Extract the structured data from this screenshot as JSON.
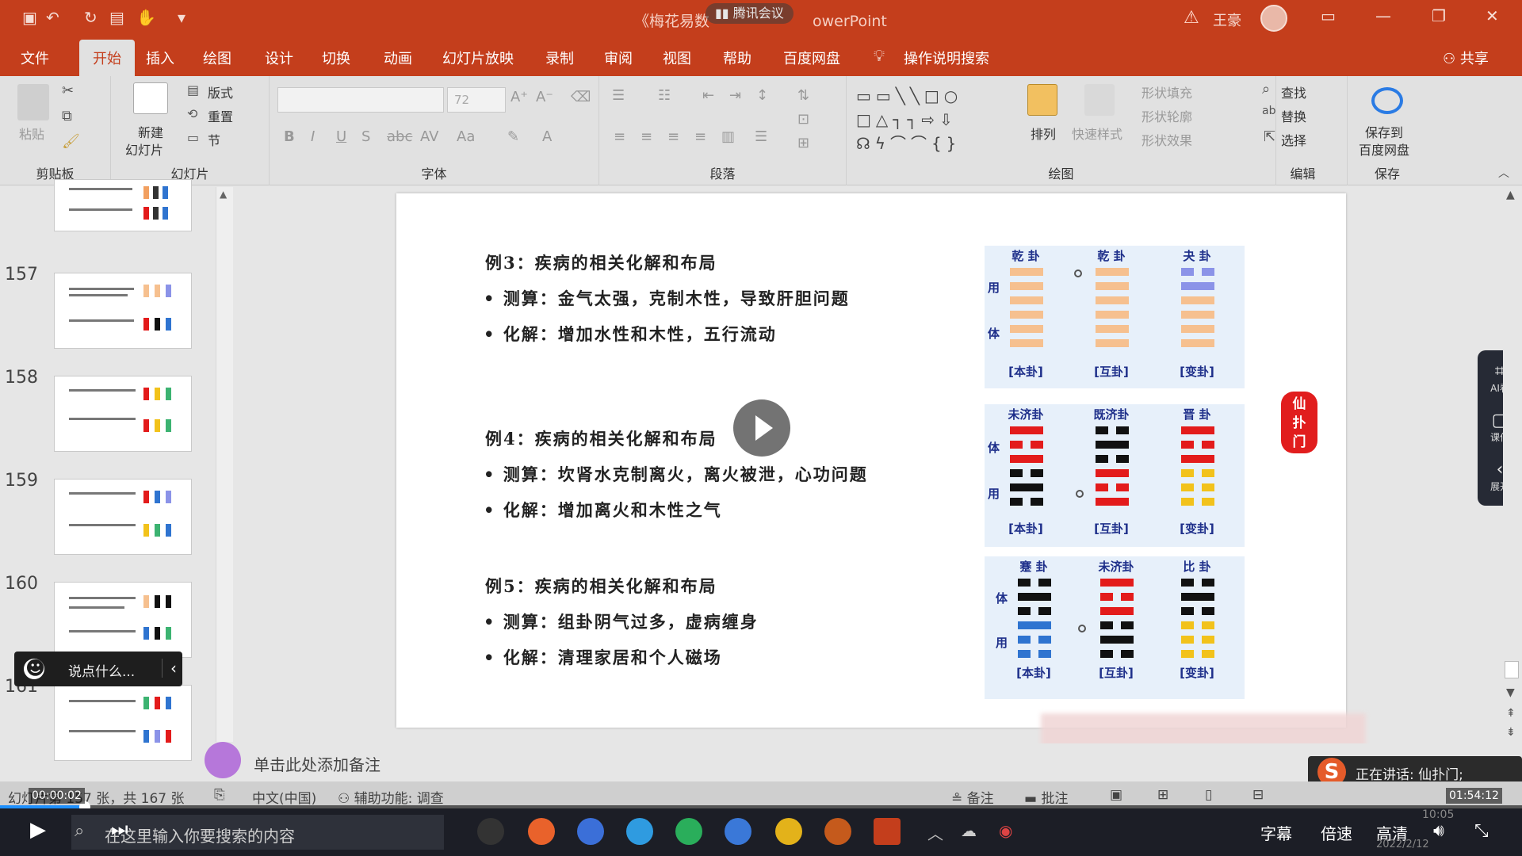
{
  "app": {
    "title_left": "《梅花易数",
    "title_right": "owerPoint",
    "meeting": "腾讯会议",
    "user": "王豪"
  },
  "menu": [
    "文件",
    "开始",
    "插入",
    "绘图",
    "设计",
    "切换",
    "动画",
    "幻灯片放映",
    "录制",
    "审阅",
    "视图",
    "帮助",
    "百度网盘",
    "操作说明搜索"
  ],
  "menu_share": "共享",
  "ribbon": {
    "clipboard": {
      "label": "剪贴板",
      "paste": "粘贴"
    },
    "slides": {
      "label": "幻灯片",
      "new_slide": "新建",
      "new_slide2": "幻灯片",
      "layout": "版式",
      "reset": "重置",
      "section": "节"
    },
    "font": {
      "label": "字体",
      "size": "72"
    },
    "paragraph": {
      "label": "段落"
    },
    "drawing": {
      "label": "绘图",
      "arrange": "排列",
      "quick_styles": "快速样式",
      "fill": "形状填充",
      "outline": "形状轮廓",
      "effects": "形状效果"
    },
    "editing": {
      "label": "编辑",
      "find": "查找",
      "replace": "替换",
      "select": "选择"
    },
    "save": {
      "label": "保存",
      "save_to": "保存到",
      "cloud": "百度网盘"
    }
  },
  "thumbnails": [
    "157",
    "158",
    "159",
    "160",
    "161"
  ],
  "comment_placeholder": "说点什么...",
  "slide": {
    "examples": [
      {
        "title": "例3：疾病的相关化解和布局",
        "measure": "• 测算：金气太强，克制木性，导致肝胆问题",
        "resolve": "• 化解：增加水性和木性，五行流动"
      },
      {
        "title": "例4：疾病的相关化解和布局",
        "measure": "• 测算：坎肾水克制离火，离火被泄，心功问题",
        "resolve": "• 化解：增加离火和木性之气"
      },
      {
        "title": "例5：疾病的相关化解和布局",
        "measure": "• 测算：组卦阴气过多，虚病缠身",
        "resolve": "• 化解：清理家居和个人磁场"
      }
    ],
    "hexagram_sets": [
      {
        "names": [
          "乾 卦",
          "乾 卦",
          "夬 卦"
        ],
        "captions": [
          "[本卦]",
          "[互卦]",
          "[变卦]"
        ],
        "side": [
          "用",
          "体"
        ]
      },
      {
        "names": [
          "未济卦",
          "既济卦",
          "晋 卦"
        ],
        "captions": [
          "[本卦]",
          "[互卦]",
          "[变卦]"
        ],
        "side": [
          "体",
          "用"
        ]
      },
      {
        "names": [
          "蹇 卦",
          "未济卦",
          "比 卦"
        ],
        "captions": [
          "[本卦]",
          "[互卦]",
          "[变卦]"
        ],
        "side": [
          "体",
          "用"
        ]
      }
    ],
    "seal_text": "仙扑门"
  },
  "notes_placeholder": "单击此处添加备注",
  "side_panel": {
    "ai": "AI看",
    "courseware": "课件",
    "expand": "展开"
  },
  "speaking": "正在讲话: 仙扑门;",
  "status": {
    "slide_info": "幻灯片第 157 张，共 167 张",
    "language": "中文(中国)",
    "accessibility": "辅助功能: 调查",
    "notes": "备注",
    "comments": "批注"
  },
  "video": {
    "elapsed": "00:00:02",
    "total": "01:54:12",
    "progress": 0.001
  },
  "taskbar": {
    "search": "在这里输入你要搜索的内容",
    "subtitle": "字幕",
    "speed": "倍速",
    "quality": "高清",
    "clock_time": "10:05",
    "clock_date": "2022/2/12"
  },
  "colors": {
    "accent": "#c43e1c",
    "hex_blue_text": "#1e2f8a",
    "yang_orange": "#f6c08f",
    "yang_red": "#e31b1b",
    "yang_black": "#111111",
    "yang_yellow": "#f2c21b",
    "yang_blue": "#2f74d0",
    "yang_lavender": "#8b93e8"
  }
}
